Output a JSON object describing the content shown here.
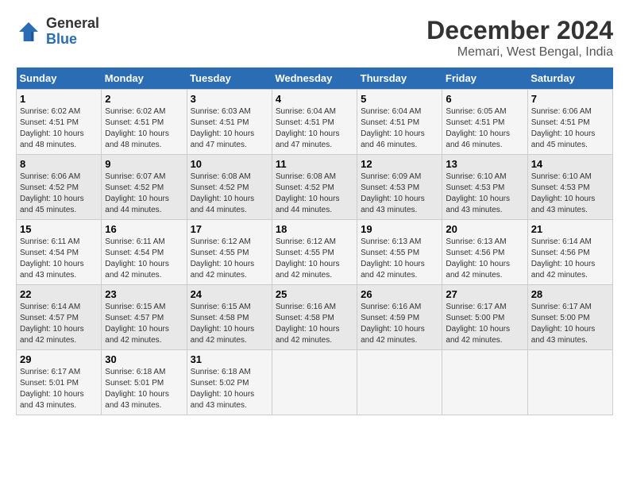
{
  "logo": {
    "line1": "General",
    "line2": "Blue"
  },
  "title": "December 2024",
  "subtitle": "Memari, West Bengal, India",
  "days_of_week": [
    "Sunday",
    "Monday",
    "Tuesday",
    "Wednesday",
    "Thursday",
    "Friday",
    "Saturday"
  ],
  "weeks": [
    [
      {
        "day": "1",
        "sunrise": "6:02 AM",
        "sunset": "4:51 PM",
        "daylight": "10 hours and 48 minutes."
      },
      {
        "day": "2",
        "sunrise": "6:02 AM",
        "sunset": "4:51 PM",
        "daylight": "10 hours and 48 minutes."
      },
      {
        "day": "3",
        "sunrise": "6:03 AM",
        "sunset": "4:51 PM",
        "daylight": "10 hours and 47 minutes."
      },
      {
        "day": "4",
        "sunrise": "6:04 AM",
        "sunset": "4:51 PM",
        "daylight": "10 hours and 47 minutes."
      },
      {
        "day": "5",
        "sunrise": "6:04 AM",
        "sunset": "4:51 PM",
        "daylight": "10 hours and 46 minutes."
      },
      {
        "day": "6",
        "sunrise": "6:05 AM",
        "sunset": "4:51 PM",
        "daylight": "10 hours and 46 minutes."
      },
      {
        "day": "7",
        "sunrise": "6:06 AM",
        "sunset": "4:51 PM",
        "daylight": "10 hours and 45 minutes."
      }
    ],
    [
      {
        "day": "8",
        "sunrise": "6:06 AM",
        "sunset": "4:52 PM",
        "daylight": "10 hours and 45 minutes."
      },
      {
        "day": "9",
        "sunrise": "6:07 AM",
        "sunset": "4:52 PM",
        "daylight": "10 hours and 44 minutes."
      },
      {
        "day": "10",
        "sunrise": "6:08 AM",
        "sunset": "4:52 PM",
        "daylight": "10 hours and 44 minutes."
      },
      {
        "day": "11",
        "sunrise": "6:08 AM",
        "sunset": "4:52 PM",
        "daylight": "10 hours and 44 minutes."
      },
      {
        "day": "12",
        "sunrise": "6:09 AM",
        "sunset": "4:53 PM",
        "daylight": "10 hours and 43 minutes."
      },
      {
        "day": "13",
        "sunrise": "6:10 AM",
        "sunset": "4:53 PM",
        "daylight": "10 hours and 43 minutes."
      },
      {
        "day": "14",
        "sunrise": "6:10 AM",
        "sunset": "4:53 PM",
        "daylight": "10 hours and 43 minutes."
      }
    ],
    [
      {
        "day": "15",
        "sunrise": "6:11 AM",
        "sunset": "4:54 PM",
        "daylight": "10 hours and 43 minutes."
      },
      {
        "day": "16",
        "sunrise": "6:11 AM",
        "sunset": "4:54 PM",
        "daylight": "10 hours and 42 minutes."
      },
      {
        "day": "17",
        "sunrise": "6:12 AM",
        "sunset": "4:55 PM",
        "daylight": "10 hours and 42 minutes."
      },
      {
        "day": "18",
        "sunrise": "6:12 AM",
        "sunset": "4:55 PM",
        "daylight": "10 hours and 42 minutes."
      },
      {
        "day": "19",
        "sunrise": "6:13 AM",
        "sunset": "4:55 PM",
        "daylight": "10 hours and 42 minutes."
      },
      {
        "day": "20",
        "sunrise": "6:13 AM",
        "sunset": "4:56 PM",
        "daylight": "10 hours and 42 minutes."
      },
      {
        "day": "21",
        "sunrise": "6:14 AM",
        "sunset": "4:56 PM",
        "daylight": "10 hours and 42 minutes."
      }
    ],
    [
      {
        "day": "22",
        "sunrise": "6:14 AM",
        "sunset": "4:57 PM",
        "daylight": "10 hours and 42 minutes."
      },
      {
        "day": "23",
        "sunrise": "6:15 AM",
        "sunset": "4:57 PM",
        "daylight": "10 hours and 42 minutes."
      },
      {
        "day": "24",
        "sunrise": "6:15 AM",
        "sunset": "4:58 PM",
        "daylight": "10 hours and 42 minutes."
      },
      {
        "day": "25",
        "sunrise": "6:16 AM",
        "sunset": "4:58 PM",
        "daylight": "10 hours and 42 minutes."
      },
      {
        "day": "26",
        "sunrise": "6:16 AM",
        "sunset": "4:59 PM",
        "daylight": "10 hours and 42 minutes."
      },
      {
        "day": "27",
        "sunrise": "6:17 AM",
        "sunset": "5:00 PM",
        "daylight": "10 hours and 42 minutes."
      },
      {
        "day": "28",
        "sunrise": "6:17 AM",
        "sunset": "5:00 PM",
        "daylight": "10 hours and 43 minutes."
      }
    ],
    [
      {
        "day": "29",
        "sunrise": "6:17 AM",
        "sunset": "5:01 PM",
        "daylight": "10 hours and 43 minutes."
      },
      {
        "day": "30",
        "sunrise": "6:18 AM",
        "sunset": "5:01 PM",
        "daylight": "10 hours and 43 minutes."
      },
      {
        "day": "31",
        "sunrise": "6:18 AM",
        "sunset": "5:02 PM",
        "daylight": "10 hours and 43 minutes."
      },
      null,
      null,
      null,
      null
    ]
  ]
}
